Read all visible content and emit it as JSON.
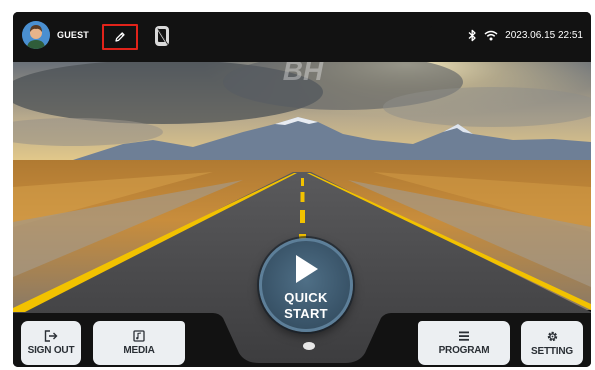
{
  "header": {
    "user_label": "GUEST",
    "datetime": "2023.06.15 22:51",
    "icons": {
      "avatar": "user-avatar",
      "edit": "pencil-icon",
      "phone": "phone-off-icon",
      "bluetooth": "bluetooth-icon",
      "wifi": "wifi-icon"
    },
    "edit_highlight_color": "#e2231a"
  },
  "background": {
    "logo": "BH"
  },
  "quick_start": {
    "line1": "QUICK",
    "line2": "START",
    "icon": "play-icon"
  },
  "bottom": {
    "sign_out": {
      "label": "SIGN OUT",
      "icon": "sign-out-icon"
    },
    "media": {
      "label": "MEDIA",
      "icon": "music-icon"
    },
    "program": {
      "label": "PROGRAM",
      "icon": "list-icon"
    },
    "setting": {
      "label": "SETTING",
      "icon": "gear-icon"
    }
  },
  "colors": {
    "bar": "#121212",
    "button": "#eceff2",
    "quick_start": "#3b566b",
    "road_line": "#f2c200"
  }
}
